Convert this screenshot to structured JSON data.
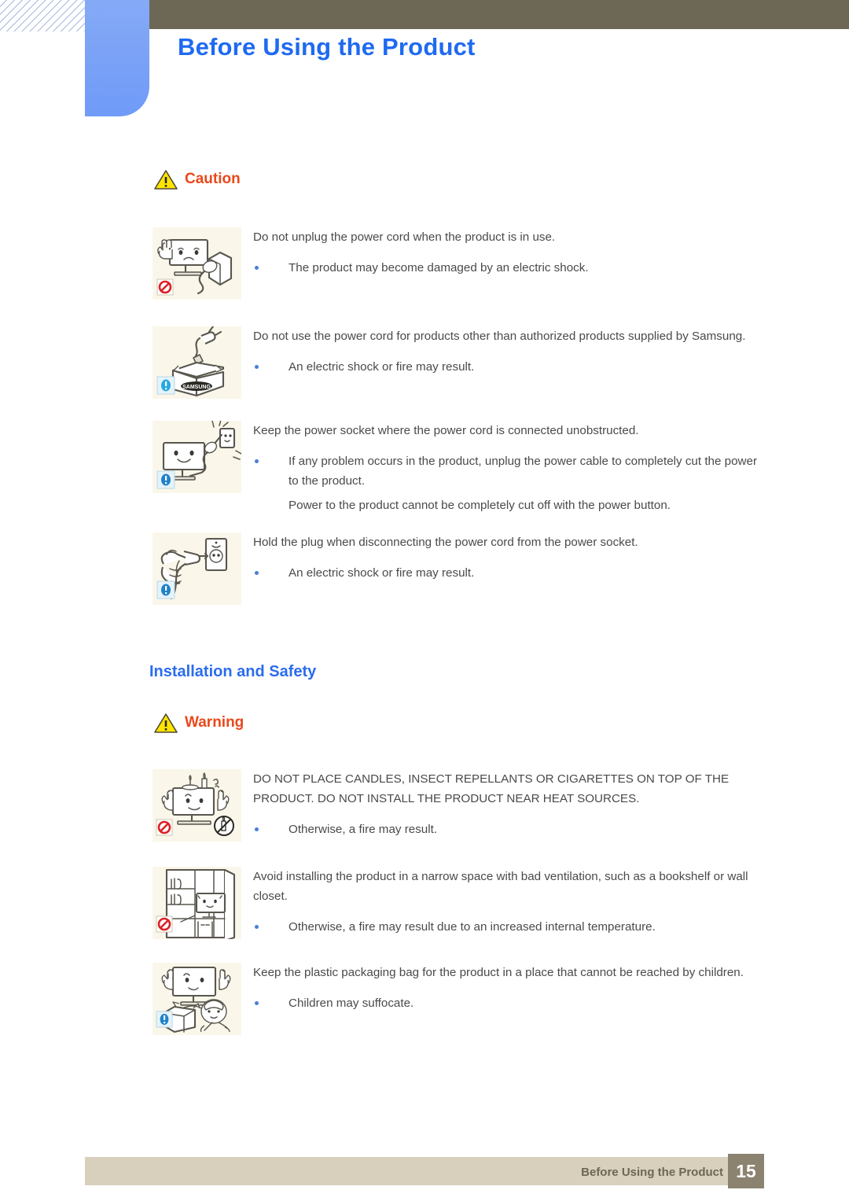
{
  "header": {
    "title": "Before Using the Product",
    "title_color": "#1f6af0",
    "bar_color": "#6c6855",
    "tab_color": "#7ba2f6"
  },
  "sections": [
    {
      "id": "caution",
      "alert_label": "Caution",
      "alert_icon": "warning-triangle-icon",
      "alert_color": "#e8491b",
      "items": [
        {
          "figure": "monitor-unplug-prohibited-icon",
          "badge": "prohibition-icon",
          "lead": "Do not unplug the power cord when the product is in use.",
          "bullets": [
            "The product may become damaged by an electric shock."
          ],
          "notes": []
        },
        {
          "figure": "plug-samsung-box-icon",
          "badge": "info-icon",
          "lead": "Do not use the power cord for products other than authorized products supplied by Samsung.",
          "bullets": [
            "An electric shock or fire may result."
          ],
          "notes": []
        },
        {
          "figure": "monitor-socket-unobstructed-icon",
          "badge": "info-icon",
          "lead": "Keep the power socket where the power cord is connected unobstructed.",
          "bullets": [
            "If any problem occurs in the product, unplug the power cable to completely cut the power to the product."
          ],
          "notes": [
            "Power to the product cannot be completely cut off with the power button."
          ]
        },
        {
          "figure": "hand-holding-plug-icon",
          "badge": "info-icon",
          "lead": "Hold the plug when disconnecting the power cord from the power socket.",
          "bullets": [
            "An electric shock or fire may result."
          ],
          "notes": []
        }
      ]
    },
    {
      "id": "installation-and-safety",
      "sub_heading": "Installation and Safety",
      "sub_heading_color": "#2b6cee",
      "alert_label": "Warning",
      "alert_icon": "warning-triangle-icon",
      "alert_color": "#e8491b",
      "items": [
        {
          "figure": "candles-on-monitor-prohibited-icon",
          "badge": "prohibition-icon",
          "badge2": "no-candle-icon",
          "lead": "DO NOT PLACE CANDLES, INSECT REPELLANTS OR CIGARETTES ON TOP OF THE PRODUCT. DO NOT INSTALL THE PRODUCT NEAR HEAT SOURCES.",
          "bullets": [
            "Otherwise, a fire may result."
          ],
          "notes": []
        },
        {
          "figure": "monitor-in-bookshelf-prohibited-icon",
          "badge": "prohibition-icon",
          "lead": "Avoid installing the product in a narrow space with bad ventilation, such as a bookshelf or wall closet.",
          "bullets": [
            "Otherwise, a fire may result due to an increased internal temperature."
          ],
          "notes": []
        },
        {
          "figure": "plastic-bag-child-icon",
          "badge": "info-icon",
          "lead": "Keep the plastic packaging bag for the product in a place that cannot be reached by children.",
          "bullets": [
            "Children may suffocate."
          ],
          "notes": []
        }
      ]
    }
  ],
  "footer": {
    "label": "Before Using the Product",
    "page_number": "15",
    "bar_color": "#d8d0bd",
    "page_box_color": "#8b8370"
  }
}
